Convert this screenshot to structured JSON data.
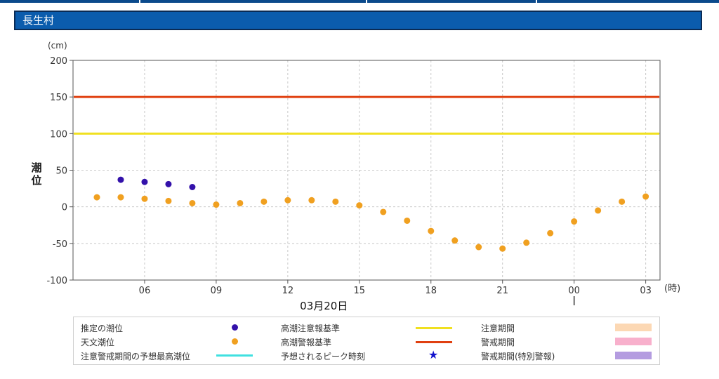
{
  "station": {
    "name": "長生村"
  },
  "chart_data": {
    "type": "scatter",
    "y_unit": "(cm)",
    "ylabel": "潮位",
    "x_unit": "(時)",
    "date_label": "03月20日",
    "ylim": [
      -100,
      200
    ],
    "y_ticks": [
      200,
      150,
      100,
      50,
      0,
      -50,
      -100
    ],
    "x_range_hours": [
      3,
      27.6
    ],
    "x_ticks": [
      {
        "hour": 6,
        "label": "06"
      },
      {
        "hour": 9,
        "label": "09"
      },
      {
        "hour": 12,
        "label": "12"
      },
      {
        "hour": 15,
        "label": "15"
      },
      {
        "hour": 18,
        "label": "18"
      },
      {
        "hour": 21,
        "label": "21"
      },
      {
        "hour": 24,
        "label": "00"
      },
      {
        "hour": 27,
        "label": "03"
      }
    ],
    "day_break_hour": 24,
    "grid": true,
    "series": [
      {
        "name": "推定の潮位",
        "color": "#3311aa",
        "x": [
          5,
          6,
          7,
          8
        ],
        "values": [
          37,
          34,
          31,
          27
        ]
      },
      {
        "name": "天文潮位",
        "color": "#f0a020",
        "x": [
          4,
          5,
          6,
          7,
          8,
          9,
          10,
          11,
          12,
          13,
          14,
          15,
          16,
          17,
          18,
          19,
          20,
          21,
          22,
          23,
          24,
          25,
          26,
          27
        ],
        "values": [
          13,
          13,
          11,
          8,
          5,
          3,
          5,
          7,
          9,
          9,
          7,
          2,
          -7,
          -19,
          -33,
          -46,
          -55,
          -57,
          -49,
          -36,
          -20,
          -5,
          7,
          14
        ]
      }
    ],
    "reference_lines": [
      {
        "name": "高潮注意報基準",
        "value": 100,
        "color": "#f0e020"
      },
      {
        "name": "高潮警報基準",
        "value": 150,
        "color": "#e04010"
      }
    ]
  },
  "legend": {
    "estimated": "推定の潮位",
    "astronomical": "天文潮位",
    "predicted_max": "注意警戒期間の予想最高潮位",
    "advisory_std": "高潮注意報基準",
    "warning_std": "高潮警報基準",
    "peak_time": "予想されるピーク時刻",
    "advisory_period": "注意期間",
    "warning_period": "警戒期間",
    "special_warning_period": "警戒期間(特別警報)",
    "colors": {
      "estimated": "#3311aa",
      "astronomical": "#f0a020",
      "predicted_max": "#40e0e0",
      "advisory_std": "#f0e020",
      "warning_std": "#e04010",
      "peak_star": "#1111cc",
      "advisory_period": "#fcd8b4",
      "warning_period": "#f8b0cc",
      "special_warning_period": "#b49ce0"
    },
    "star_glyph": "★"
  }
}
